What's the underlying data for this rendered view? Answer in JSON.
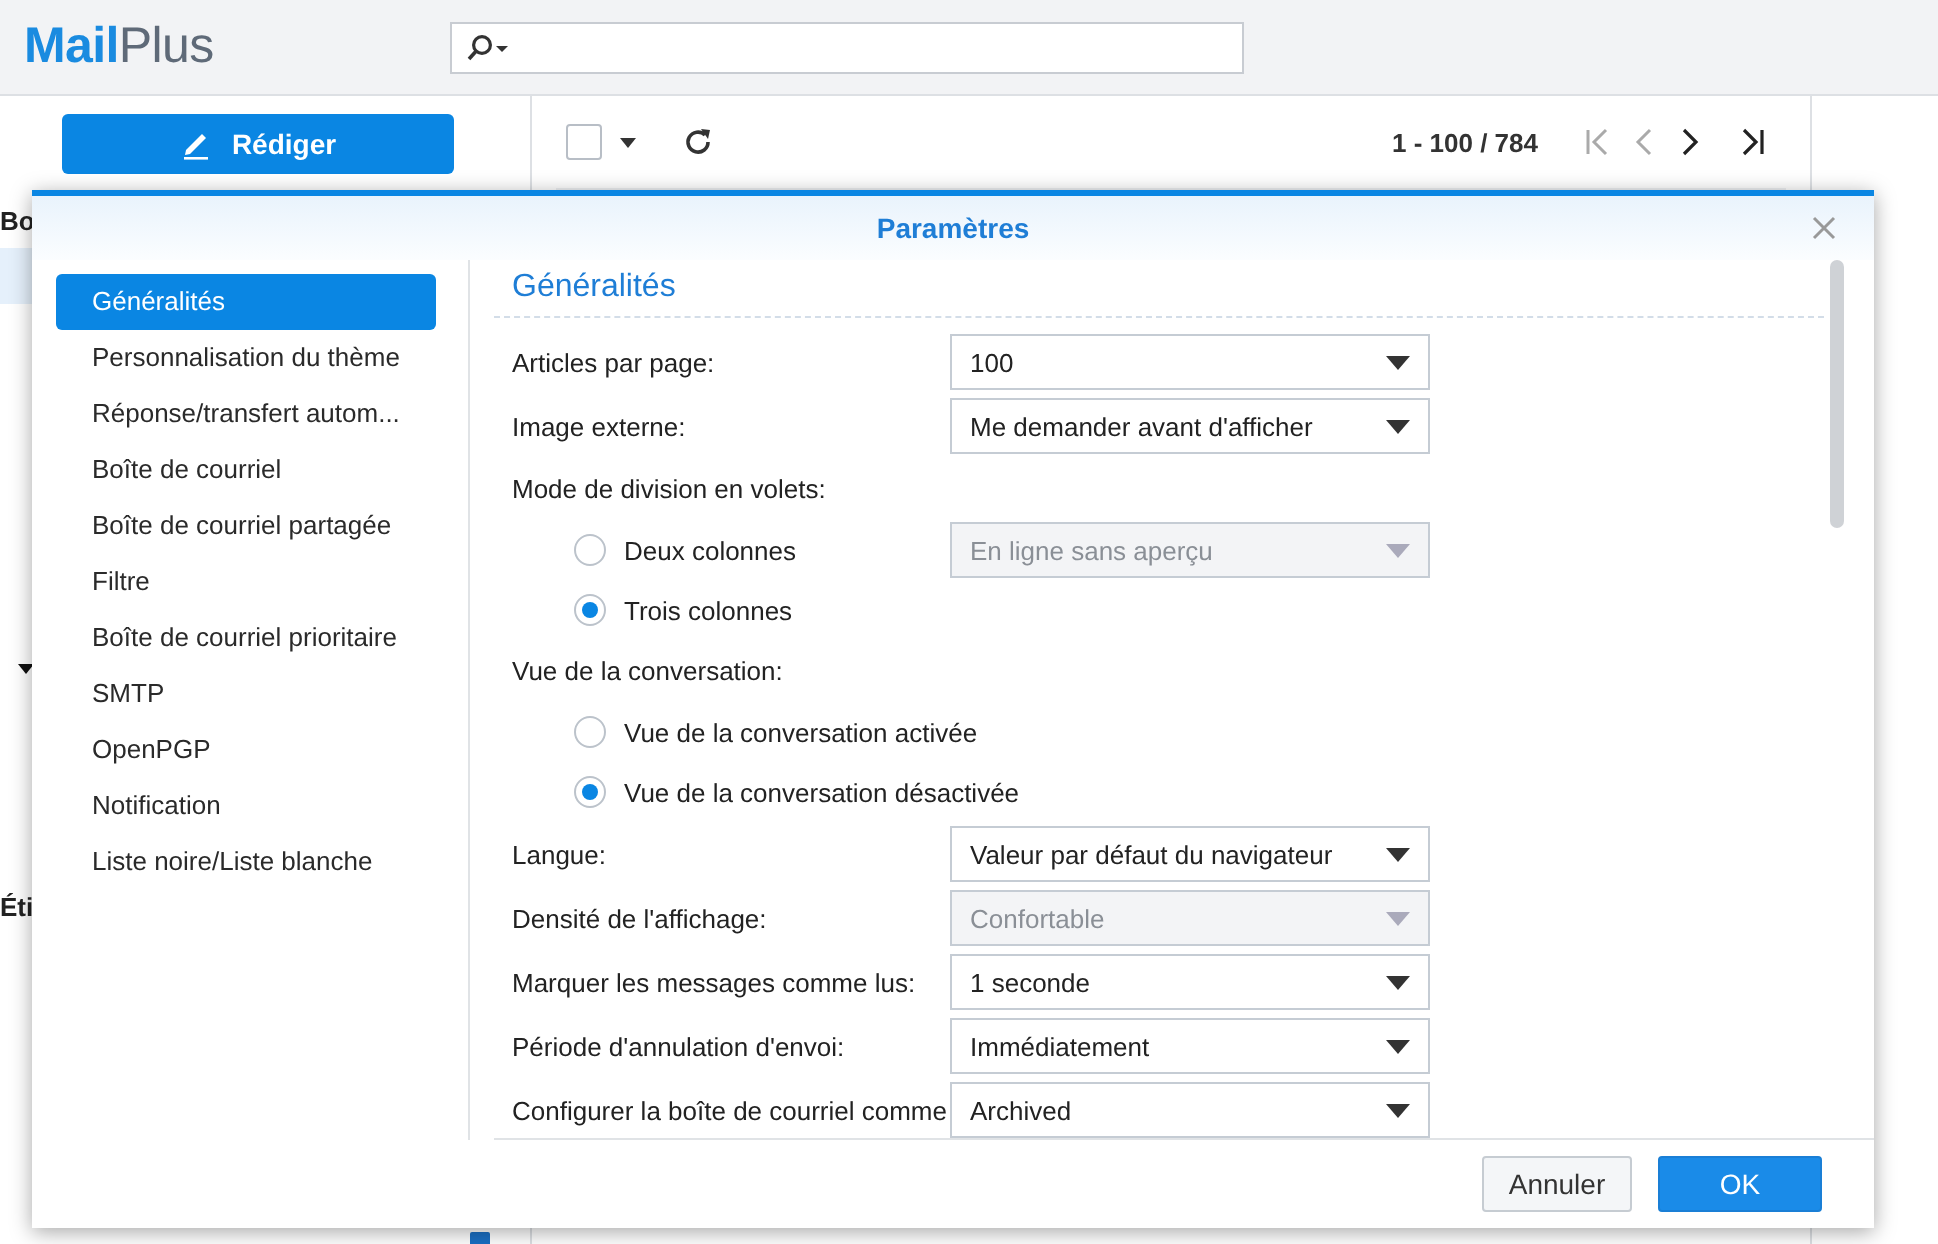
{
  "app": {
    "logo": [
      "Mail",
      "Plus"
    ],
    "compose_button": "Rédiger",
    "pager": "1 - 100 / 784"
  },
  "select_all": {
    "checked": false
  },
  "sidebar": {
    "texts": [
      "Bo",
      "Éti"
    ]
  },
  "dialog": {
    "title": "Paramètres",
    "nav": [
      {
        "label": "Généralités",
        "selected": true
      },
      {
        "label": "Personnalisation du thème",
        "selected": false
      },
      {
        "label": "Réponse/transfert autom...",
        "selected": false
      },
      {
        "label": "Boîte de courriel",
        "selected": false
      },
      {
        "label": "Boîte de courriel partagée",
        "selected": false
      },
      {
        "label": "Filtre",
        "selected": false
      },
      {
        "label": "Boîte de courriel prioritaire",
        "selected": false
      },
      {
        "label": "SMTP",
        "selected": false
      },
      {
        "label": "OpenPGP",
        "selected": false
      },
      {
        "label": "Notification",
        "selected": false
      },
      {
        "label": "Liste noire/Liste blanche",
        "selected": false
      }
    ],
    "section_title": "Généralités",
    "settings": [
      {
        "kind": "select",
        "label": "Articles par page:",
        "value": "100",
        "disabled": false
      },
      {
        "kind": "select",
        "label": "Image externe:",
        "value": "Me demander avant d'afficher",
        "disabled": false
      },
      {
        "kind": "heading",
        "label": "Mode de division en volets:"
      },
      {
        "kind": "radio",
        "label": "Deux colonnes",
        "selected": false,
        "select": {
          "value": "En ligne sans aperçu",
          "disabled": true
        }
      },
      {
        "kind": "radio",
        "label": "Trois colonnes",
        "selected": true
      },
      {
        "kind": "heading",
        "label": "Vue de la conversation:"
      },
      {
        "kind": "radio",
        "label": "Vue de la conversation activée",
        "selected": false
      },
      {
        "kind": "radio",
        "label": "Vue de la conversation désactivée",
        "selected": true
      },
      {
        "kind": "select",
        "label": "Langue:",
        "value": "Valeur par défaut du navigateur",
        "disabled": false
      },
      {
        "kind": "select",
        "label": "Densité de l'affichage:",
        "value": "Confortable",
        "disabled": true
      },
      {
        "kind": "select",
        "label": "Marquer les messages comme lus:",
        "value": "1 seconde",
        "disabled": false
      },
      {
        "kind": "select",
        "label": "Période d'annulation d'envoi:",
        "value": "Immédiatement",
        "disabled": false
      },
      {
        "kind": "select",
        "label": "Configurer la boîte de courriel comme",
        "value": "Archived",
        "disabled": false
      }
    ],
    "buttons": [
      {
        "label": "Annuler",
        "kind": "secondary"
      },
      {
        "label": "OK",
        "kind": "primary"
      }
    ]
  }
}
